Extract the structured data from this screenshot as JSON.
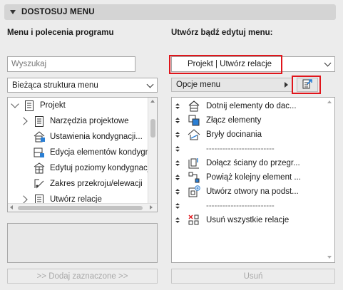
{
  "header": {
    "title": "DOSTOSUJ MENU"
  },
  "left": {
    "title": "Menu i polecenia programu",
    "search_placeholder": "Wyszukaj",
    "structure_select": "Bieżąca struktura menu",
    "tree": [
      {
        "label": "Projekt",
        "icon": "document-list-icon",
        "expand": "down",
        "level": 0
      },
      {
        "label": "Narzędzia projektowe",
        "icon": "document-list-icon",
        "expand": "right",
        "level": 1
      },
      {
        "label": "Ustawienia kondygnacji...",
        "icon": "story-settings-icon",
        "expand": "",
        "level": 1
      },
      {
        "label": "Edycja elementów kondygn",
        "icon": "story-edit-icon",
        "expand": "",
        "level": 1
      },
      {
        "label": "Edytuj poziomy kondygnacji",
        "icon": "story-levels-icon",
        "expand": "",
        "level": 1
      },
      {
        "label": "Zakres przekroju/elewacji",
        "icon": "section-range-icon",
        "expand": "",
        "level": 1
      },
      {
        "label": "Utwórz relacje",
        "icon": "document-list-icon",
        "expand": "right",
        "level": 1
      }
    ],
    "add_button": ">> Dodaj zaznaczone >>"
  },
  "right": {
    "title": "Utwórz bądź edytuj menu:",
    "menu_select": "Projekt | Utwórz relacje",
    "options_button": "Opcje menu",
    "items": [
      {
        "label": "Dotnij elementy do dac...",
        "icon": "trim-to-roof-icon",
        "separator": false
      },
      {
        "label": "Złącz elementy",
        "icon": "merge-elements-icon",
        "separator": false
      },
      {
        "label": "Bryły docinania",
        "icon": "trimming-bodies-icon",
        "separator": false
      },
      {
        "label": "-------------------------",
        "icon": "",
        "separator": true
      },
      {
        "label": "Dołącz ściany do przegr...",
        "icon": "attach-walls-icon",
        "separator": false
      },
      {
        "label": "Powiąż kolejny element ...",
        "icon": "link-element-icon",
        "separator": false
      },
      {
        "label": "Utwórz otwory na podst...",
        "icon": "create-openings-icon",
        "separator": false
      },
      {
        "label": "-------------------------",
        "icon": "",
        "separator": true
      },
      {
        "label": "Usuń wszystkie relacje",
        "icon": "remove-relations-icon",
        "separator": false
      }
    ],
    "remove_button": "Usuń"
  },
  "colors": {
    "highlight": "#e0151b",
    "accent_blue": "#2b7fd4"
  }
}
